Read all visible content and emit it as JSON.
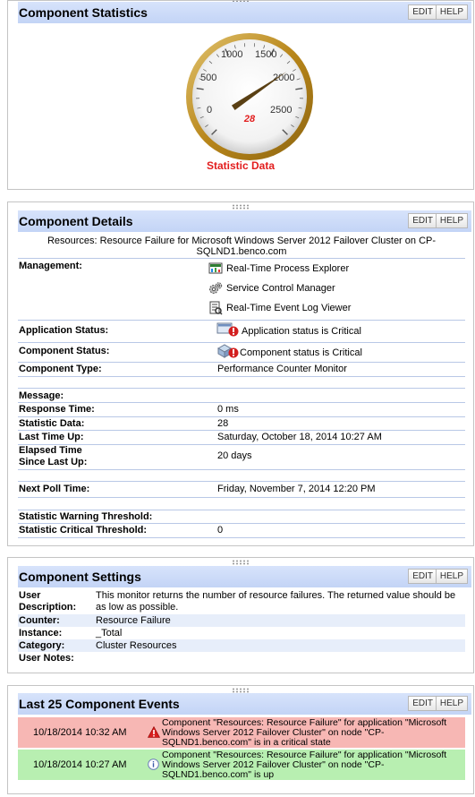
{
  "buttons": {
    "edit": "EDIT",
    "help": "HELP"
  },
  "statistics": {
    "title": "Component Statistics",
    "gauge": {
      "tick_labels": [
        "0",
        "500",
        "1000",
        "1500",
        "2000",
        "2500"
      ],
      "value": 28,
      "value_text": "28",
      "min": 0,
      "max": 2500
    },
    "caption": "Statistic Data"
  },
  "details": {
    "title": "Component Details",
    "subtitle_line1": "Resources: Resource Failure for Microsoft Windows Server 2012 Failover Cluster on CP-",
    "subtitle_line2": "SQLND1.benco.com",
    "management_label": "Management:",
    "management_items": [
      {
        "label": "Real-Time Process Explorer",
        "icon": "process-explorer-icon"
      },
      {
        "label": "Service Control Manager",
        "icon": "gears-icon"
      },
      {
        "label": "Real-Time Event Log Viewer",
        "icon": "event-log-icon"
      }
    ],
    "app_status_label": "Application Status:",
    "app_status_value": "Application status is Critical",
    "comp_status_label": "Component Status:",
    "comp_status_value": "Component status is Critical",
    "comp_type_label": "Component Type:",
    "comp_type_value": "Performance Counter Monitor",
    "message_label": "Message:",
    "response_label": "Response Time:",
    "response_value": "0 ms",
    "statdata_label": "Statistic Data:",
    "statdata_value": "28",
    "lastup_label": "Last Time Up:",
    "lastup_value": "Saturday, October 18, 2014 10:27 AM",
    "elapsed_label_1": "Elapsed Time",
    "elapsed_label_2": "Since Last Up:",
    "elapsed_value": "20 days",
    "nextpoll_label": "Next Poll Time:",
    "nextpoll_value": "Friday, November 7, 2014 12:20 PM",
    "warn_label": "Statistic Warning Threshold:",
    "crit_label": "Statistic Critical Threshold:",
    "crit_value": "0"
  },
  "settings": {
    "title": "Component Settings",
    "desc_label_1": "User",
    "desc_label_2": "Description:",
    "desc_value": "This monitor returns the number of resource failures. The returned value should be as low as possible.",
    "counter_label": "Counter:",
    "counter_value": "Resource Failure",
    "instance_label": "Instance:",
    "instance_value": "_Total",
    "category_label": "Category:",
    "category_value": "Cluster Resources",
    "notes_label": "User Notes:"
  },
  "events": {
    "title": "Last 25 Component Events",
    "rows": [
      {
        "date": "10/18/2014 10:32 AM",
        "type": "critical",
        "text": "Component \"Resources: Resource Failure\" for application \"Microsoft Windows Server 2012 Failover Cluster\" on node \"CP-SQLND1.benco.com\" is in a critical state"
      },
      {
        "date": "10/18/2014 10:27 AM",
        "type": "up",
        "text": "Component \"Resources: Resource Failure\" for application \"Microsoft Windows Server 2012 Failover Cluster\" on node \"CP-SQLND1.benco.com\" is up"
      }
    ]
  },
  "colors": {
    "header": "#c9d8f7",
    "critical_row": "#f7b7b4",
    "up_row": "#b8efb1",
    "gauge_caption": "#e21d1d"
  }
}
